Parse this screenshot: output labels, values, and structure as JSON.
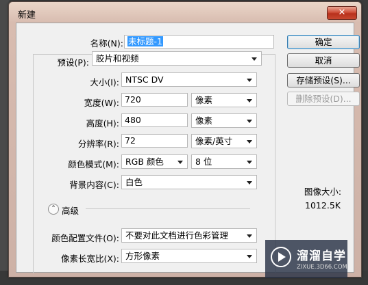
{
  "window": {
    "title": "新建"
  },
  "form": {
    "name": {
      "label": "名称(N):",
      "value": "未标题-1"
    },
    "preset": {
      "label": "预设(P):",
      "value": "胶片和视频"
    },
    "size": {
      "label": "大小(I):",
      "value": "NTSC DV"
    },
    "width": {
      "label": "宽度(W):",
      "value": "720",
      "unit": "像素"
    },
    "height": {
      "label": "高度(H):",
      "value": "480",
      "unit": "像素"
    },
    "resolution": {
      "label": "分辨率(R):",
      "value": "72",
      "unit": "像素/英寸"
    },
    "color_mode": {
      "label": "颜色模式(M):",
      "value": "RGB 颜色",
      "depth": "8 位"
    },
    "background": {
      "label": "背景内容(C):",
      "value": "白色"
    },
    "advanced": {
      "label": "高级"
    },
    "color_profile": {
      "label": "颜色配置文件(O):",
      "value": "不要对此文档进行色彩管理"
    },
    "pixel_aspect": {
      "label": "像素长宽比(X):",
      "value": "方形像素"
    }
  },
  "buttons": {
    "ok": "确定",
    "cancel": "取消",
    "save_preset": "存储预设(S)...",
    "delete_preset": "删除预设(D)..."
  },
  "image_size": {
    "label": "图像大小:",
    "value": "1012.5K"
  },
  "watermark": {
    "title": "溜溜自学",
    "url": "ZIXUE.3D66.COM"
  },
  "colors": {
    "selection": "#3399ff",
    "close_button": "#c8482f",
    "default_button_border": "#3c7fb1"
  }
}
